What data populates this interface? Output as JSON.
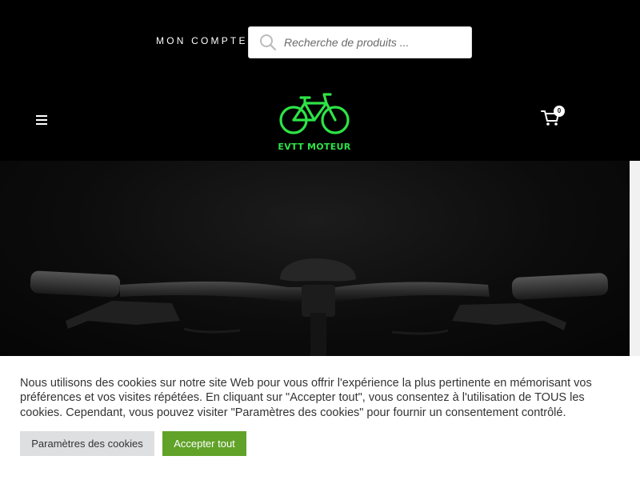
{
  "topbar": {
    "account_label": "MON COMPTE",
    "search": {
      "placeholder": "Recherche de produits ..."
    }
  },
  "header": {
    "logo_text": "EVTT MOTEUR",
    "cart_count": "0"
  },
  "colors": {
    "background": "#000000",
    "logo_green": "#2ee346",
    "accept_button": "#61a229",
    "settings_button": "#dedfe0"
  },
  "icons": [
    "search-icon",
    "menu-icon",
    "bicycle-logo-icon",
    "shopping-cart-icon"
  ],
  "hero": {
    "image": "bike-handlebar-photo"
  },
  "cookie_banner": {
    "text": "Nous utilisons des cookies sur notre site Web pour vous offrir l'expérience la plus pertinente en mémorisant vos préférences et vos visites répétées. En cliquant sur \"Accepter tout\", vous consentez à l'utilisation de TOUS les cookies. Cependant, vous pouvez visiter \"Paramètres des cookies\" pour fournir un consentement contrôlé.",
    "settings_label": "Paramètres des cookies",
    "accept_label": "Accepter tout"
  }
}
